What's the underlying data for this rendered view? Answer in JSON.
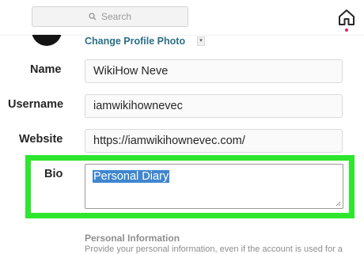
{
  "search": {
    "placeholder": "Search"
  },
  "profile": {
    "change_photo_label": "Change Profile Photo"
  },
  "form": {
    "name": {
      "label": "Name",
      "value": "WikiHow Neve"
    },
    "username": {
      "label": "Username",
      "value": "iamwikihownevec"
    },
    "website": {
      "label": "Website",
      "value": "https://iamwikihownevec.com/"
    },
    "bio": {
      "label": "Bio",
      "value": "Personal Diary"
    }
  },
  "personal_info": {
    "title": "Personal Information",
    "description": "Provide your personal information, even if the account is used for a"
  },
  "icons": {
    "search": "search-icon",
    "home": "home-icon"
  },
  "colors": {
    "highlight": "#2de62d",
    "link": "#2b6f86",
    "selection": "#3f86cf",
    "notification": "#e0245e"
  }
}
